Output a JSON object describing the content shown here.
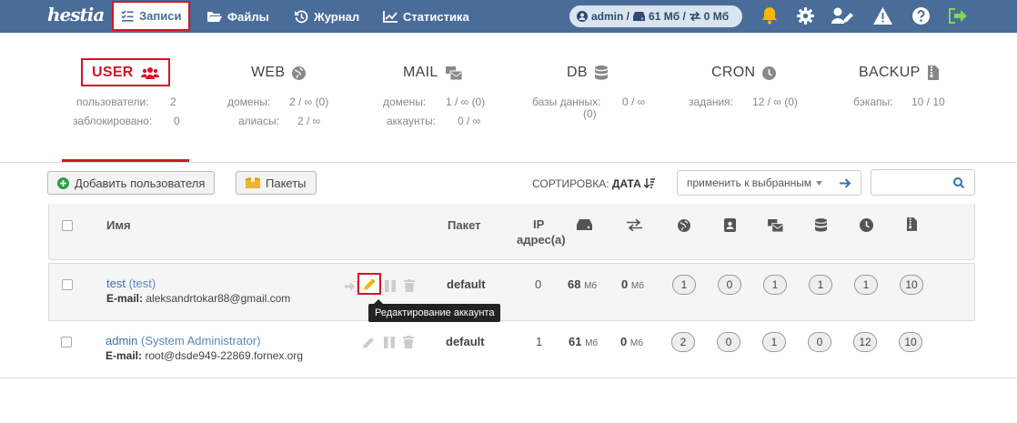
{
  "topbar": {
    "logo": "hestia",
    "nav": [
      {
        "label": "Записи",
        "active": true
      },
      {
        "label": "Файлы"
      },
      {
        "label": "Журнал"
      },
      {
        "label": "Статистика"
      }
    ],
    "user_pill": {
      "user": "admin /",
      "disk": "61 Мб /",
      "bandwidth": "0 Мб"
    }
  },
  "stats": {
    "user": {
      "title": "USER",
      "lines": [
        {
          "label": "пользователи:",
          "value": "2"
        },
        {
          "label": "заблокировано:",
          "value": "0"
        }
      ]
    },
    "web": {
      "title": "WEB",
      "lines": [
        {
          "label": "домены:",
          "value": "2 / ∞ (0)"
        },
        {
          "label": "алиасы:",
          "value": "2 / ∞"
        }
      ]
    },
    "mail": {
      "title": "MAIL",
      "lines": [
        {
          "label": "домены:",
          "value": "1 / ∞ (0)"
        },
        {
          "label": "аккаунты:",
          "value": "0 / ∞"
        }
      ]
    },
    "db": {
      "title": "DB",
      "lines": [
        {
          "label": "базы данных:",
          "label2": "(0)",
          "value": "0 / ∞"
        }
      ]
    },
    "cron": {
      "title": "CRON",
      "lines": [
        {
          "label": "задания:",
          "value": "12 / ∞ (0)"
        }
      ]
    },
    "backup": {
      "title": "BACKUP",
      "lines": [
        {
          "label": "бэкапы:",
          "value": "10 / 10"
        }
      ]
    }
  },
  "toolbar": {
    "add_user": "Добавить пользователя",
    "packages": "Пакеты",
    "sort_label": "СОРТИРОВКА:",
    "sort_value": "ДАТА",
    "apply_select": "применить к выбранным"
  },
  "table": {
    "headers": {
      "name": "Имя",
      "package": "Пакет",
      "ip1": "IP",
      "ip2": "адрес(а)"
    },
    "rows": [
      {
        "user": "test",
        "full": "(test)",
        "email_label": "E-mail:",
        "email": "aleksandrtokar88@gmail.com",
        "package": "default",
        "ip": "0",
        "disk": "68",
        "disk_unit": "Мб",
        "bw": "0",
        "bw_unit": "Мб",
        "web": "1",
        "dns": "0",
        "mail": "1",
        "db": "1",
        "cron": "1",
        "backup": "10"
      },
      {
        "user": "admin",
        "full": "(System Administrator)",
        "email_label": "E-mail:",
        "email": "root@dsde949-22869.fornex.org",
        "package": "default",
        "ip": "1",
        "disk": "61",
        "disk_unit": "Мб",
        "bw": "0",
        "bw_unit": "Мб",
        "web": "2",
        "dns": "0",
        "mail": "1",
        "db": "0",
        "cron": "12",
        "backup": "10"
      }
    ]
  },
  "tooltip": "Редактирование аккаунта",
  "colors": {
    "topbar": "#4a6c99",
    "accent": "#d51426",
    "link": "#3d6fa6",
    "warning_icon": "#f5b800",
    "logout_icon": "#7ed957"
  }
}
